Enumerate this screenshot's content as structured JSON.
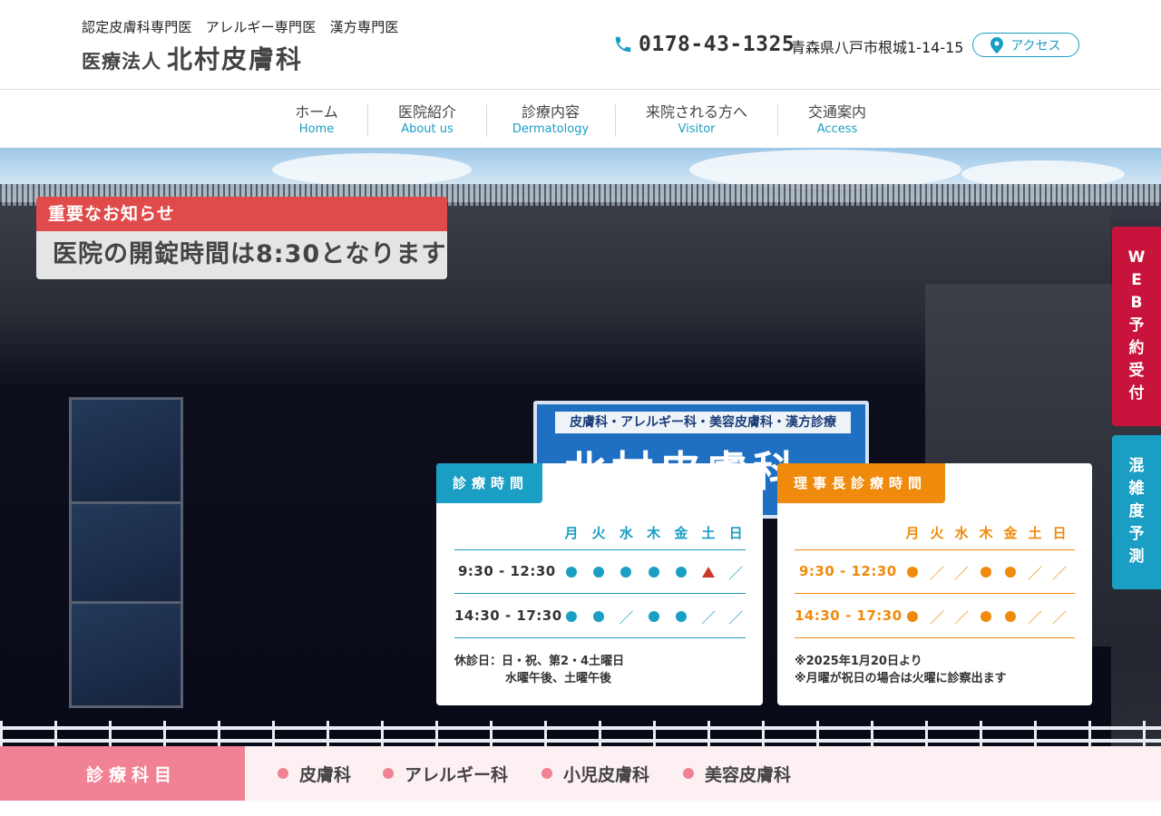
{
  "header": {
    "subtitle": "認定皮膚科専門医　アレルギー専門医　漢方専門医",
    "title_prefix": "医療法人",
    "title_main": "北村皮膚科",
    "phone": "0178-43-1325",
    "address": "青森県八戸市根城1-14-15",
    "access_label": "アクセス",
    "accent_color": "#1a9ec4"
  },
  "nav": {
    "items": [
      {
        "ja": "ホーム",
        "en": "Home"
      },
      {
        "ja": "医院紹介",
        "en": "About us"
      },
      {
        "ja": "診療内容",
        "en": "Dermatology"
      },
      {
        "ja": "来院される方へ",
        "en": "Visitor"
      },
      {
        "ja": "交通案内",
        "en": "Access"
      }
    ]
  },
  "hero": {
    "sign_sub": "皮膚科・アレルギー科・美容皮膚科・漢方診療",
    "sign_main": "北村皮膚科"
  },
  "notice": {
    "heading": "重要なお知らせ",
    "body": "医院の開錠時間は8:30となります",
    "color": "#e04a4a"
  },
  "schedule": {
    "days": [
      "月",
      "火",
      "水",
      "木",
      "金",
      "土",
      "日"
    ],
    "clinic": {
      "title": "診療時間",
      "color": "#1a9ec4",
      "rows": [
        {
          "time": "9:30 - 12:30",
          "marks": [
            "dot",
            "dot",
            "dot",
            "dot",
            "dot",
            "triangle",
            "slash"
          ]
        },
        {
          "time": "14:30 - 17:30",
          "marks": [
            "dot",
            "dot",
            "slash",
            "dot",
            "dot",
            "slash",
            "slash"
          ]
        }
      ],
      "note_line1": "休診日：日・祝、第2・4土曜日",
      "note_line2": "水曜午後、土曜午後"
    },
    "director": {
      "title": "理事長診療時間",
      "color": "#f08a0c",
      "rows": [
        {
          "time": "9:30 - 12:30",
          "marks": [
            "dot",
            "slash",
            "slash",
            "dot",
            "dot",
            "slash",
            "slash"
          ]
        },
        {
          "time": "14:30 - 17:30",
          "marks": [
            "dot",
            "slash",
            "slash",
            "dot",
            "dot",
            "slash",
            "slash"
          ]
        }
      ],
      "note_line1": "※2025年1月20日より",
      "note_line2": "※月曜が祝日の場合は火曜に診察出ます"
    }
  },
  "side_tabs": {
    "web_reservation": "WEB予約受付",
    "congestion": "混雑度予測"
  },
  "departments": {
    "label": "診療科目",
    "items": [
      "皮膚科",
      "アレルギー科",
      "小児皮膚科",
      "美容皮膚科"
    ],
    "color": "#f08293"
  }
}
